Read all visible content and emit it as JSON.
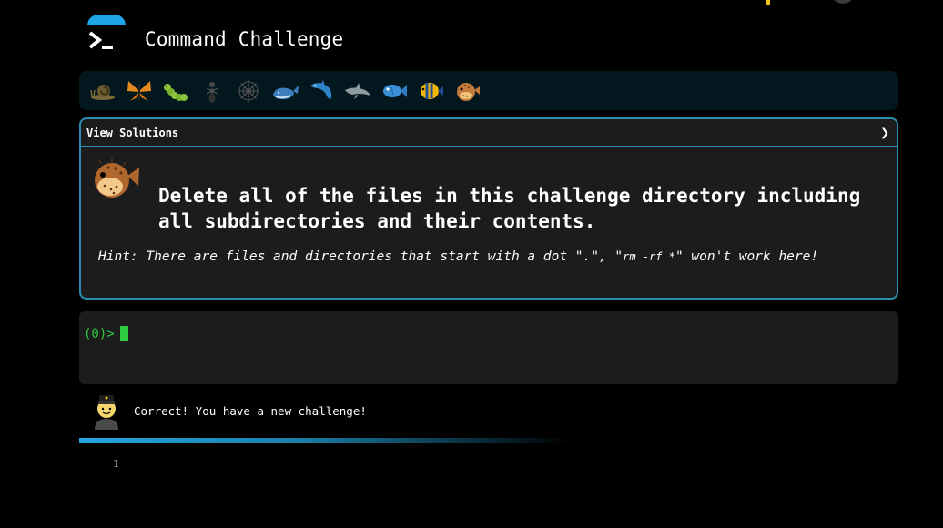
{
  "app": {
    "title": "Command Challenge"
  },
  "levels": [
    {
      "name": "snail-icon"
    },
    {
      "name": "butterfly-icon"
    },
    {
      "name": "caterpillar-icon"
    },
    {
      "name": "ant-icon"
    },
    {
      "name": "spiderweb-icon"
    },
    {
      "name": "whale-icon"
    },
    {
      "name": "dolphin-icon"
    },
    {
      "name": "dolphin-gray-icon"
    },
    {
      "name": "fish-icon"
    },
    {
      "name": "tropical-fish-icon"
    },
    {
      "name": "blowfish-icon"
    }
  ],
  "panel": {
    "toggle_label": "View Solutions",
    "chevron": "❯",
    "challenge": "Delete all of the files in this challenge directory including all subdirectories and their contents.",
    "hint_prefix": "Hint: There are files and directories that start with a dot \".\", \"",
    "hint_code": "rm -rf *",
    "hint_suffix": "\" won't work here!"
  },
  "terminal": {
    "prompt": "(0)>"
  },
  "feedback": {
    "message": "Correct! You have a new challenge!"
  },
  "editor": {
    "line_number": "1"
  },
  "colors": {
    "accent": "#2b8db0",
    "prompt": "#2ecc40",
    "background": "#000000"
  }
}
